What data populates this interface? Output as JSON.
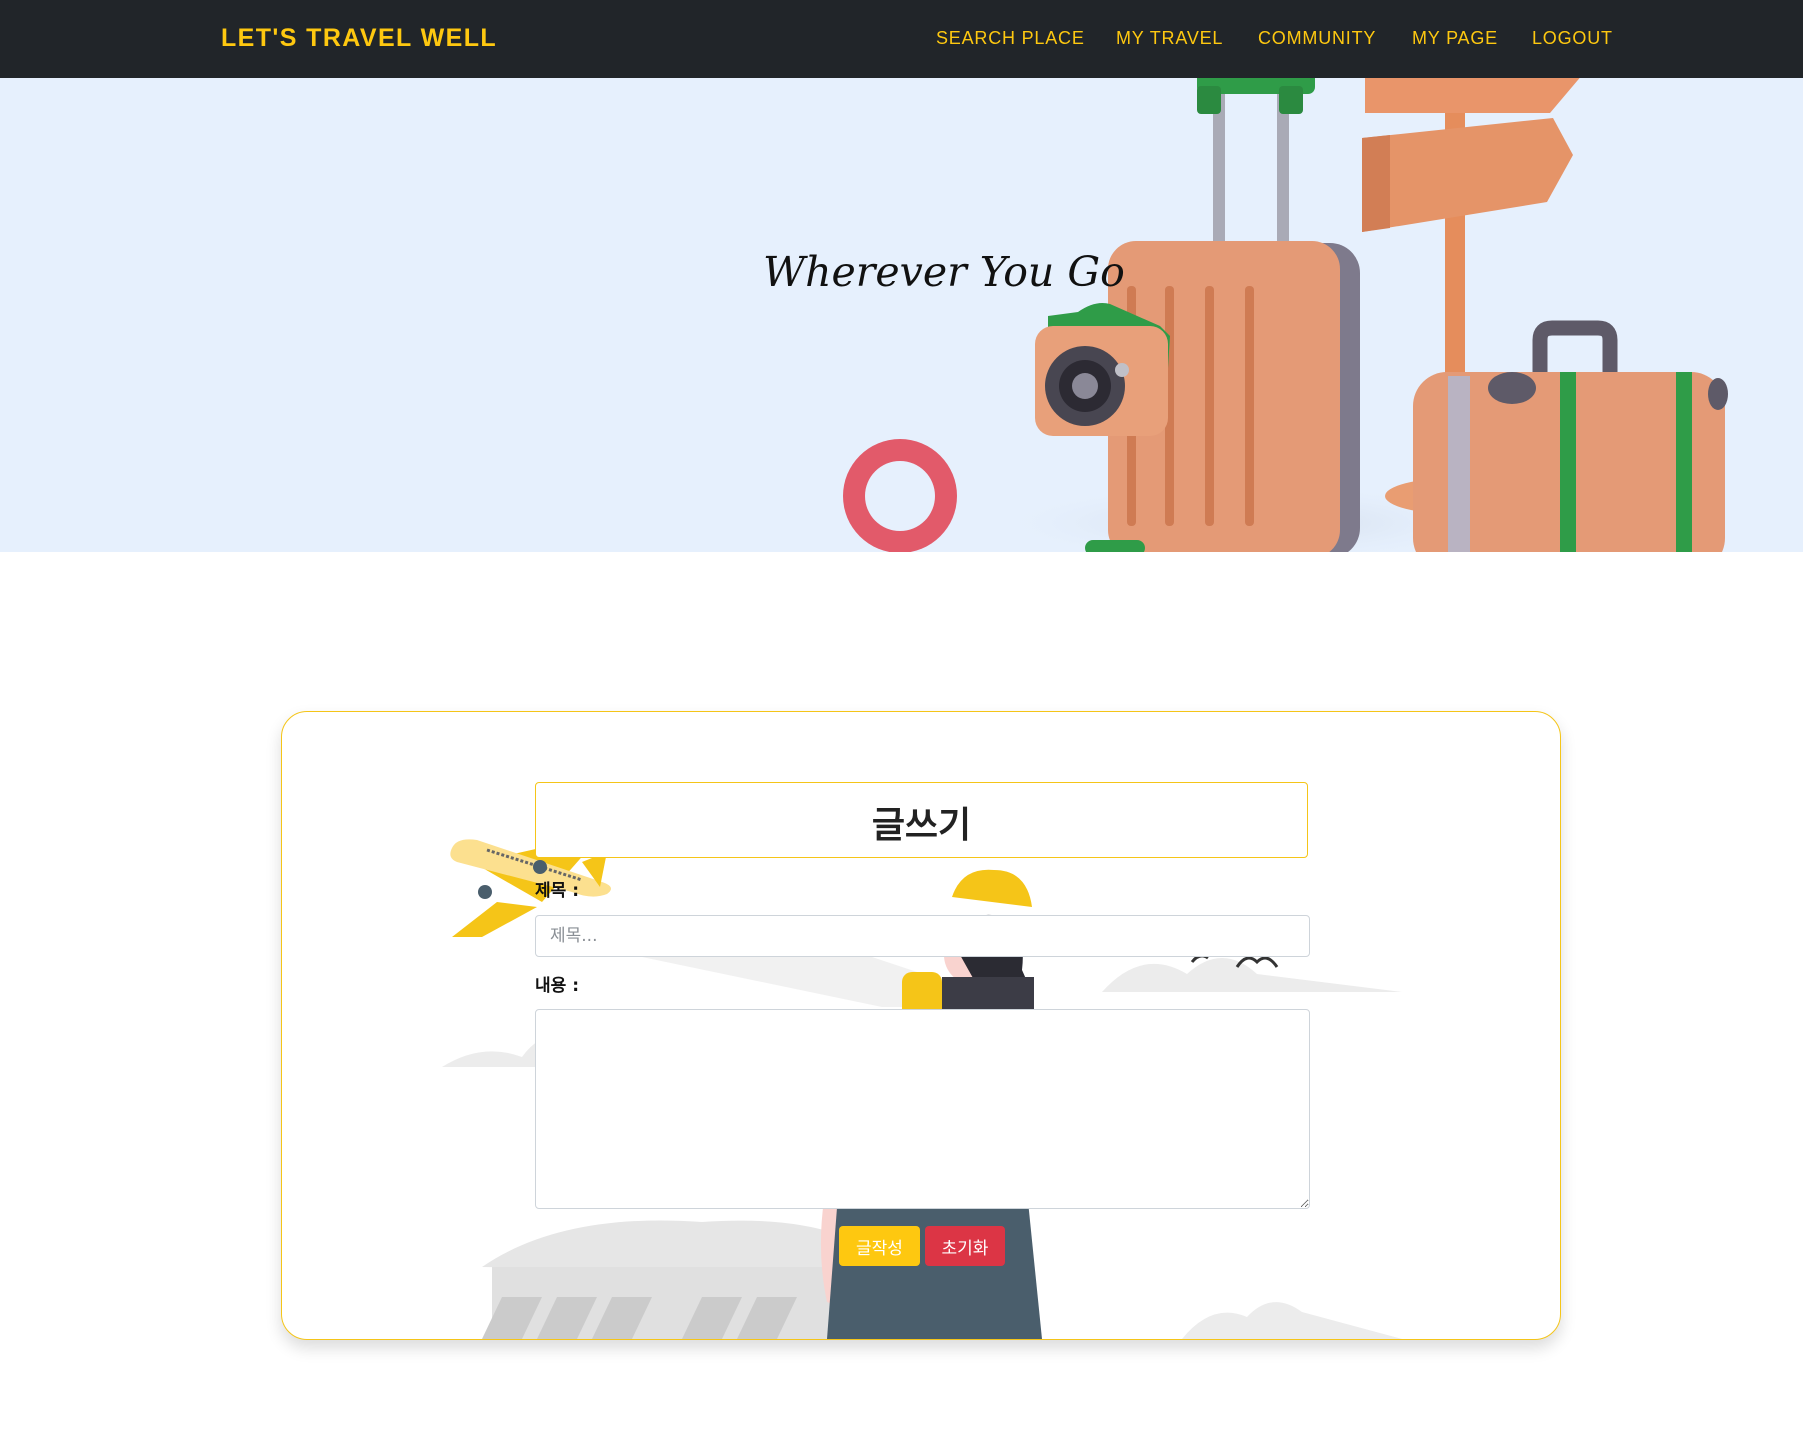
{
  "navbar": {
    "brand": "LET'S TRAVEL WELL",
    "items": [
      {
        "label": "SEARCH PLACE"
      },
      {
        "label": "MY TRAVEL"
      },
      {
        "label": "COMMUNITY"
      },
      {
        "label": "MY PAGE"
      },
      {
        "label": "LOGOUT"
      }
    ]
  },
  "hero": {
    "title": "Wherever You Go"
  },
  "form": {
    "heading": "글쓰기",
    "title_label": "제목 :",
    "title_placeholder": "제목...",
    "title_value": "",
    "content_label": "내용 :",
    "content_value": "",
    "submit_label": "글작성",
    "reset_label": "초기화"
  },
  "colors": {
    "accent": "#fec810",
    "navbar_bg": "#212529",
    "hero_bg": "#e6f0fd",
    "danger": "#dc3545"
  }
}
